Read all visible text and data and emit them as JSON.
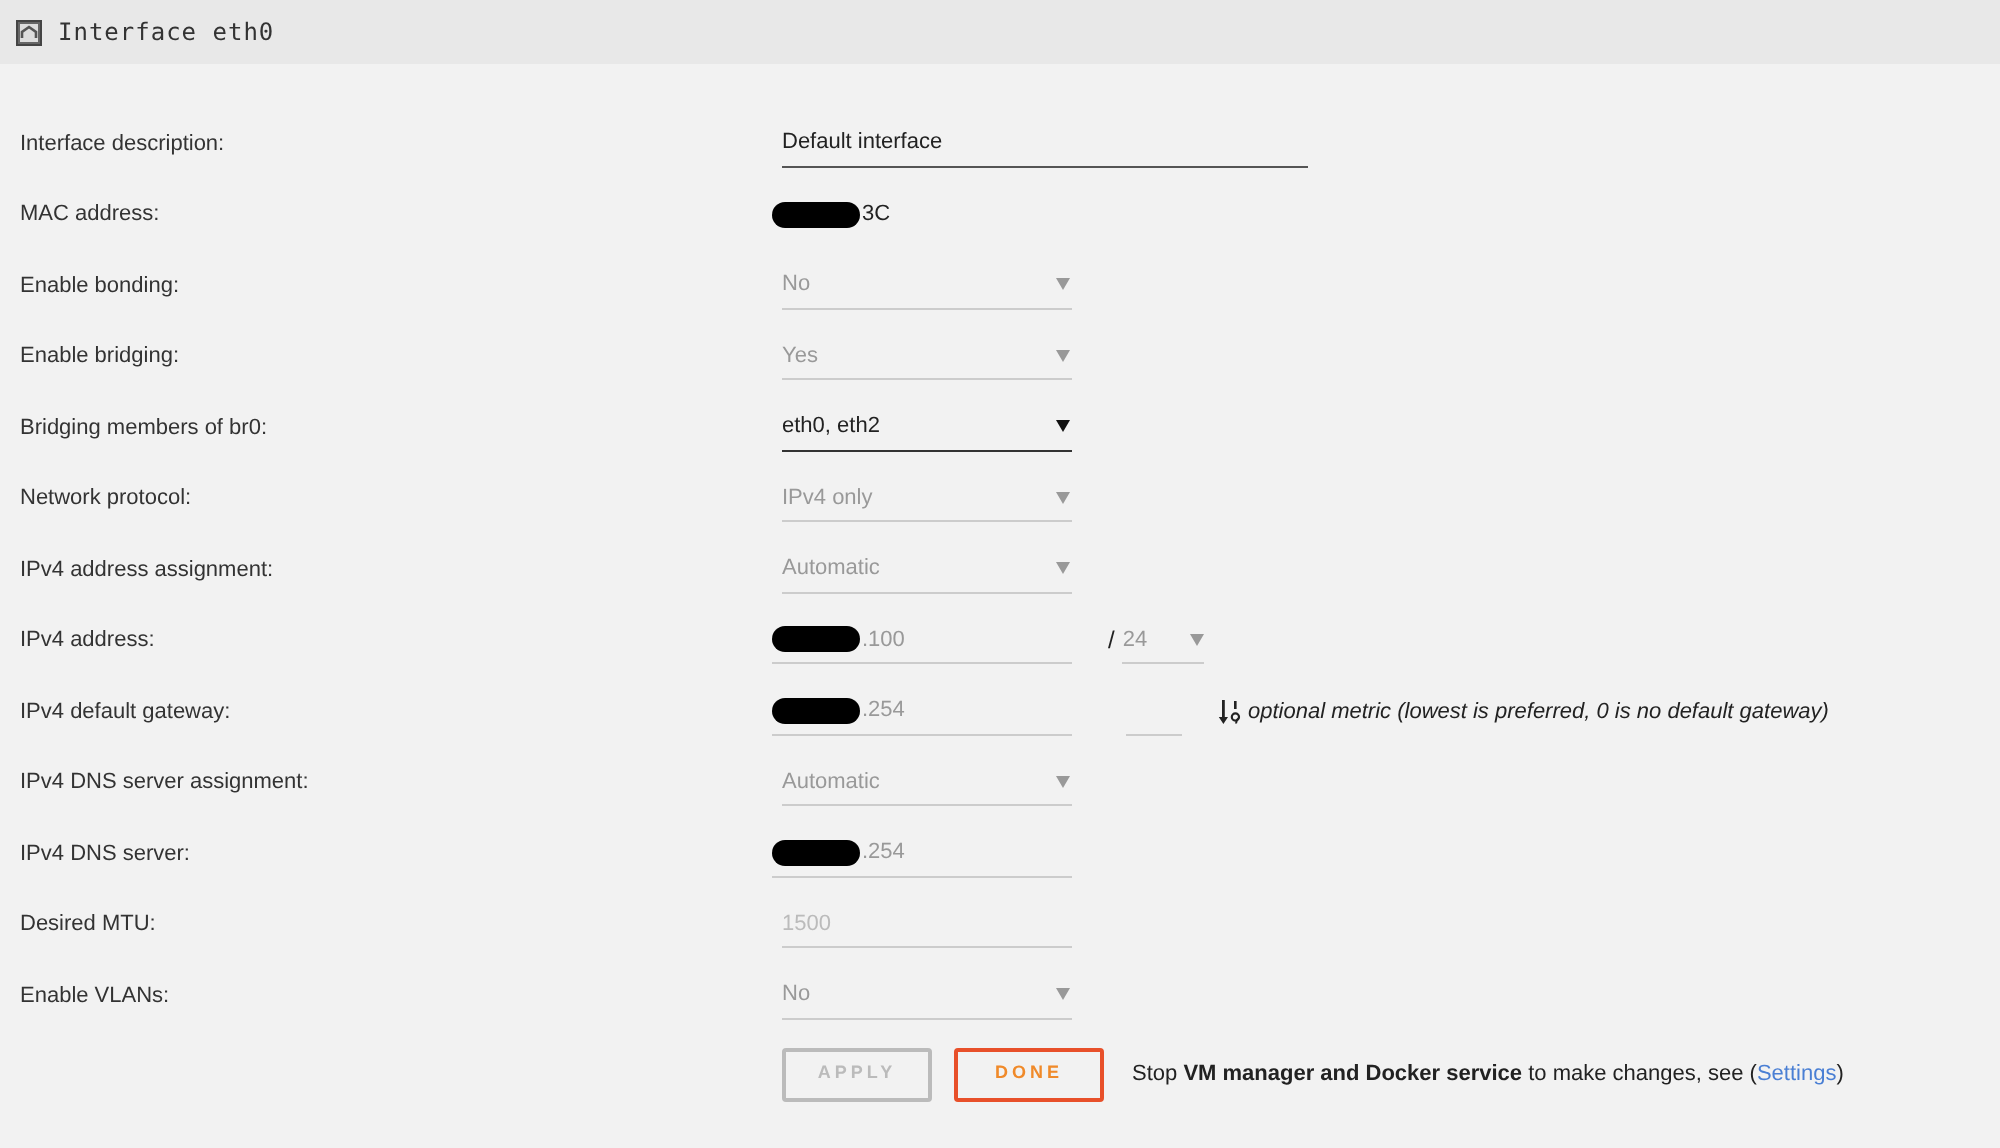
{
  "header": {
    "title": "Interface eth0"
  },
  "rows": [
    {
      "label": "Interface description:",
      "kind": "text",
      "disabled": false,
      "value": "Default interface"
    },
    {
      "label": "MAC address:",
      "kind": "static",
      "redacted": true,
      "value": "3C"
    },
    {
      "label": "Enable bonding:",
      "kind": "select",
      "disabled": true,
      "value": "No"
    },
    {
      "label": "Enable bridging:",
      "kind": "select",
      "disabled": true,
      "value": "Yes"
    },
    {
      "label": "Bridging members of br0:",
      "kind": "select",
      "disabled": false,
      "value": "eth0, eth2"
    },
    {
      "label": "Network protocol:",
      "kind": "select",
      "disabled": true,
      "value": "IPv4 only"
    },
    {
      "label": "IPv4 address assignment:",
      "kind": "select",
      "disabled": true,
      "value": "Automatic"
    },
    {
      "label": "IPv4 address:",
      "kind": "input",
      "disabled": true,
      "redacted": true,
      "value": ".100",
      "prefix": {
        "separator": "/",
        "value": "24"
      }
    },
    {
      "label": "IPv4 default gateway:",
      "kind": "input",
      "disabled": true,
      "redacted": true,
      "value": ".254",
      "metric_note": "optional metric (lowest is preferred, 0 is no default gateway)"
    },
    {
      "label": "IPv4 DNS server assignment:",
      "kind": "select",
      "disabled": true,
      "value": "Automatic"
    },
    {
      "label": "IPv4 DNS server:",
      "kind": "input",
      "disabled": true,
      "redacted": true,
      "value": ".254"
    },
    {
      "label": "Desired MTU:",
      "kind": "input",
      "disabled": true,
      "placeholder": "1500"
    },
    {
      "label": "Enable VLANs:",
      "kind": "select",
      "disabled": true,
      "value": "No"
    }
  ],
  "buttons": [
    {
      "label": "APPLY",
      "disabled": true
    },
    {
      "label": "DONE",
      "disabled": false
    }
  ],
  "note": {
    "text": "Stop **VM manager and Docker service** to make changes, see (",
    "link": "Settings",
    "after": ")"
  }
}
